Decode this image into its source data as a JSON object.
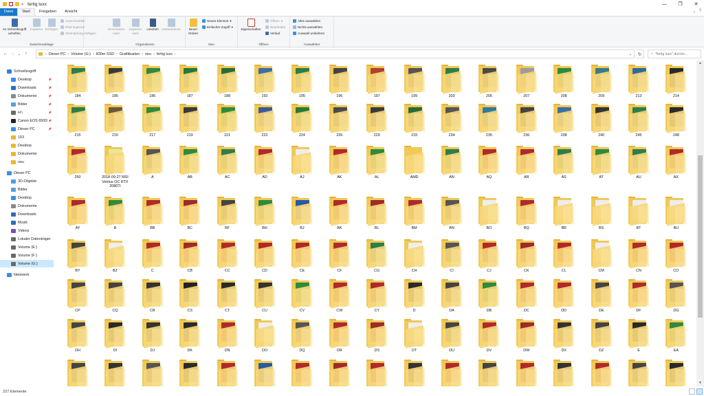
{
  "window": {
    "title": "fertig luxx",
    "minimize": "—",
    "maximize": "❐",
    "close": "✕"
  },
  "quick_access_toolbar": {
    "dropdown": "▾"
  },
  "ribbon_tabs": [
    {
      "label": "Datei",
      "kind": "file"
    },
    {
      "label": "Start",
      "kind": "active"
    },
    {
      "label": "Freigeben",
      "kind": ""
    },
    {
      "label": "Ansicht",
      "kind": ""
    }
  ],
  "ribbon_right": {
    "expand": "⌄",
    "help": "?"
  },
  "ribbon": {
    "clipboard": {
      "group": "Zwischenablage",
      "pin": "An Schnellzugriff anheften",
      "copy": "Kopieren",
      "paste": "Einfügen",
      "cut": "Ausschneiden",
      "copy_path": "Pfad kopieren",
      "paste_shortcut": "Verknüpfung einfügen"
    },
    "organize": {
      "group": "Organisieren",
      "move_to": "Verschieben nach",
      "copy_to": "Kopieren nach",
      "delete": "Löschen",
      "rename": "Umbenennen"
    },
    "new": {
      "group": "Neu",
      "new_folder": "Neuer Ordner",
      "new_item": "Neues Element",
      "easy_access": "Einfacher Zugriff"
    },
    "open": {
      "group": "Öffnen",
      "properties": "Eigenschaften",
      "open": "Öffnen",
      "edit": "Bearbeiten",
      "history": "Verlauf"
    },
    "select": {
      "group": "Auswählen",
      "select_all": "Alles auswählen",
      "select_none": "Nichts auswählen",
      "invert": "Auswahl umkehren"
    }
  },
  "address_bar": {
    "path": [
      "Dieser PC",
      "Volume (G:)",
      "830er SSD",
      "Grafikkarten",
      "neu",
      "fertig luxx"
    ],
    "search_placeholder": "\"fertig luxx\" durchs..."
  },
  "sidebar": [
    {
      "label": "Schnellzugriff",
      "icon": "star-icon",
      "color": "#2f7fd8",
      "indent": 0,
      "pin": false
    },
    {
      "label": "Desktop",
      "icon": "desktop-icon",
      "color": "#3a8fe0",
      "indent": 1,
      "pin": true
    },
    {
      "label": "Downloads",
      "icon": "download-icon",
      "color": "#2a6fc0",
      "indent": 1,
      "pin": true
    },
    {
      "label": "Dokumente",
      "icon": "documents-icon",
      "color": "#8a8a8a",
      "indent": 1,
      "pin": true
    },
    {
      "label": "Bilder",
      "icon": "pictures-icon",
      "color": "#5aa0d8",
      "indent": 1,
      "pin": true
    },
    {
      "label": "H:\\",
      "icon": "drive-icon",
      "color": "#6a6a6a",
      "indent": 1,
      "pin": true
    },
    {
      "label": "Canon EOS 650D",
      "icon": "camera-icon",
      "color": "#222222",
      "indent": 1,
      "pin": true
    },
    {
      "label": "Dieser PC",
      "icon": "computer-icon",
      "color": "#3a8fe0",
      "indent": 1,
      "pin": true
    },
    {
      "label": "153",
      "icon": "folder-icon",
      "color": "#e8b830",
      "indent": 1,
      "pin": false
    },
    {
      "label": "Desktop",
      "icon": "folder-icon",
      "color": "#e8b830",
      "indent": 1,
      "pin": false
    },
    {
      "label": "Dokumente",
      "icon": "folder-icon",
      "color": "#e8b830",
      "indent": 1,
      "pin": false
    },
    {
      "label": "neu",
      "icon": "folder-icon",
      "color": "#e8b830",
      "indent": 1,
      "pin": false
    },
    {
      "label": "Dieser PC",
      "icon": "computer-icon",
      "color": "#3a8fe0",
      "indent": 0,
      "pin": false
    },
    {
      "label": "3D-Objekte",
      "icon": "3d-objects-icon",
      "color": "#4aa0e8",
      "indent": 1,
      "pin": false
    },
    {
      "label": "Bilder",
      "icon": "pictures-icon",
      "color": "#5aa0d8",
      "indent": 1,
      "pin": false
    },
    {
      "label": "Desktop",
      "icon": "desktop-icon",
      "color": "#3a8fe0",
      "indent": 1,
      "pin": false
    },
    {
      "label": "Dokumente",
      "icon": "documents-icon",
      "color": "#8a8a8a",
      "indent": 1,
      "pin": false
    },
    {
      "label": "Downloads",
      "icon": "download-icon",
      "color": "#2a6fc0",
      "indent": 1,
      "pin": false
    },
    {
      "label": "Musik",
      "icon": "music-icon",
      "color": "#2a6fc0",
      "indent": 1,
      "pin": false
    },
    {
      "label": "Videos",
      "icon": "videos-icon",
      "color": "#7a4ac0",
      "indent": 1,
      "pin": false
    },
    {
      "label": "Lokaler Datenträger",
      "icon": "drive-icon",
      "color": "#6a6a6a",
      "indent": 1,
      "pin": false
    },
    {
      "label": "Volume (E:)",
      "icon": "drive-icon",
      "color": "#6a6a6a",
      "indent": 1,
      "pin": false
    },
    {
      "label": "Volume (F:)",
      "icon": "drive-icon",
      "color": "#6a6a6a",
      "indent": 1,
      "pin": false
    },
    {
      "label": "Volume (G:)",
      "icon": "drive-icon",
      "color": "#6a6a6a",
      "indent": 1,
      "pin": false,
      "selected": true
    },
    {
      "label": "Netzwerk",
      "icon": "network-icon",
      "color": "#3a8fe0",
      "indent": 0,
      "pin": false
    }
  ],
  "folders": [
    {
      "name": "184",
      "thumb": "#2e7d4a"
    },
    {
      "name": "185",
      "thumb": "#3a3a3a"
    },
    {
      "name": "186",
      "thumb": "#2f8a3c"
    },
    {
      "name": "187",
      "thumb": "#247a3a"
    },
    {
      "name": "188",
      "thumb": "#2a6b3a"
    },
    {
      "name": "192",
      "thumb": "#3c6ea8"
    },
    {
      "name": "195",
      "thumb": "#2d7d45"
    },
    {
      "name": "196",
      "thumb": "#444444"
    },
    {
      "name": "197",
      "thumb": "#b0412e"
    },
    {
      "name": "199",
      "thumb": "#555555"
    },
    {
      "name": "203",
      "thumb": "#2e7d4a"
    },
    {
      "name": "206",
      "thumb": "#4a4a4a"
    },
    {
      "name": "207",
      "thumb": "#9c9c9c"
    },
    {
      "name": "208",
      "thumb": "#2f8a3c"
    },
    {
      "name": "209",
      "thumb": "#3a7a8a"
    },
    {
      "name": "213",
      "thumb": "#2f6aa0"
    },
    {
      "name": "214",
      "thumb": "#2a2a2a"
    },
    {
      "name": "215",
      "thumb": "#2e7d4a"
    },
    {
      "name": "216",
      "thumb": "#6a5a3a"
    },
    {
      "name": "217",
      "thumb": "#2f8a3c"
    },
    {
      "name": "219",
      "thumb": "#3a3a3a"
    },
    {
      "name": "221",
      "thumb": "#2f8a3c"
    },
    {
      "name": "222",
      "thumb": "#3a5a9a"
    },
    {
      "name": "224",
      "thumb": "#2a7a3a"
    },
    {
      "name": "226",
      "thumb": "#4a4a4a"
    },
    {
      "name": "229",
      "thumb": "#3a3a3a"
    },
    {
      "name": "233",
      "thumb": "#2a6a3a"
    },
    {
      "name": "234",
      "thumb": "#555555"
    },
    {
      "name": "235",
      "thumb": "#2f7aa0"
    },
    {
      "name": "236",
      "thumb": "#444444"
    },
    {
      "name": "238",
      "thumb": "#3a6ea8"
    },
    {
      "name": "240",
      "thumb": "#333333"
    },
    {
      "name": "245",
      "thumb": "#2e7d4a"
    },
    {
      "name": "248",
      "thumb": "#2a2a2a"
    },
    {
      "name": "250",
      "thumb": "#b02a2a"
    },
    {
      "name": "2018-09-27 MSI Ventus OC RTX 2080Ti",
      "thumb": "#3a3a3a",
      "open": true
    },
    {
      "name": "A",
      "thumb": "#555555"
    },
    {
      "name": "AB",
      "thumb": "#2f8a3c"
    },
    {
      "name": "AC",
      "thumb": "#2e7d4a"
    },
    {
      "name": "AD",
      "thumb": "#b02a2a"
    },
    {
      "name": "AJ",
      "thumb": "#eeeeee"
    },
    {
      "name": "AK",
      "thumb": "#b02a2a"
    },
    {
      "name": "AL",
      "thumb": "#2f8a3c"
    },
    {
      "name": "AMD",
      "thumb": "#f0c956"
    },
    {
      "name": "AN",
      "thumb": "#2e7d4a"
    },
    {
      "name": "AQ",
      "thumb": "#b02a2a"
    },
    {
      "name": "AR",
      "thumb": "#b02a2a"
    },
    {
      "name": "AS",
      "thumb": "#2e7d4a"
    },
    {
      "name": "AT",
      "thumb": "#2f8a3c"
    },
    {
      "name": "AU",
      "thumb": "#2e7d4a"
    },
    {
      "name": "AX",
      "thumb": "#b02a2a"
    },
    {
      "name": "AY",
      "thumb": "#b02a2a"
    },
    {
      "name": "B",
      "thumb": "#2f8a3c"
    },
    {
      "name": "BB",
      "thumb": "#b02a2a"
    },
    {
      "name": "BC",
      "thumb": "#a02a2a"
    },
    {
      "name": "BF",
      "thumb": "#444444"
    },
    {
      "name": "BH",
      "thumb": "#2f8a3c"
    },
    {
      "name": "BJ",
      "thumb": "#2a5aa0"
    },
    {
      "name": "BK",
      "thumb": "#b02a2a"
    },
    {
      "name": "BL",
      "thumb": "#a02a2a"
    },
    {
      "name": "BM",
      "thumb": "#b02a2a"
    },
    {
      "name": "BN",
      "thumb": "#555555"
    },
    {
      "name": "BO",
      "thumb": "#eeeeee"
    },
    {
      "name": "BQ",
      "thumb": "#b02a2a"
    },
    {
      "name": "BR",
      "thumb": "#eeeeee"
    },
    {
      "name": "BS",
      "thumb": "#eeeeee"
    },
    {
      "name": "BT",
      "thumb": "#eeeeee"
    },
    {
      "name": "BU",
      "thumb": "#eeeeee"
    },
    {
      "name": "BY",
      "thumb": "#444444"
    },
    {
      "name": "BZ",
      "thumb": "#eeeeee"
    },
    {
      "name": "C",
      "thumb": "#b02a2a"
    },
    {
      "name": "CB",
      "thumb": "#a02a2a"
    },
    {
      "name": "CC",
      "thumb": "#b02a2a"
    },
    {
      "name": "CD",
      "thumb": "#b02a2a"
    },
    {
      "name": "CE",
      "thumb": "#b02a2a"
    },
    {
      "name": "CF",
      "thumb": "#b02a2a"
    },
    {
      "name": "CG",
      "thumb": "#2e7d4a"
    },
    {
      "name": "CH",
      "thumb": "#eeeeee"
    },
    {
      "name": "CI",
      "thumb": "#555555"
    },
    {
      "name": "CJ",
      "thumb": "#b02a2a"
    },
    {
      "name": "CK",
      "thumb": "#a02a2a"
    },
    {
      "name": "CL",
      "thumb": "#b02a2a"
    },
    {
      "name": "CM",
      "thumb": "#eeeeee"
    },
    {
      "name": "CN",
      "thumb": "#b02a2a"
    },
    {
      "name": "CO",
      "thumb": "#b02a2a"
    },
    {
      "name": "CP",
      "thumb": "#444444"
    },
    {
      "name": "CQ",
      "thumb": "#444444"
    },
    {
      "name": "CR",
      "thumb": "#333333"
    },
    {
      "name": "CS",
      "thumb": "#222222"
    },
    {
      "name": "CT",
      "thumb": "#2a2a2a"
    },
    {
      "name": "CU",
      "thumb": "#333333"
    },
    {
      "name": "CV",
      "thumb": "#2f8a3c"
    },
    {
      "name": "CW",
      "thumb": "#b02a2a"
    },
    {
      "name": "CY",
      "thumb": "#b02a2a"
    },
    {
      "name": "D",
      "thumb": "#2a2a2a"
    },
    {
      "name": "DA",
      "thumb": "#444444"
    },
    {
      "name": "DB",
      "thumb": "#2f8a3c"
    },
    {
      "name": "DC",
      "thumb": "#b02a2a"
    },
    {
      "name": "DD",
      "thumb": "#b02a2a"
    },
    {
      "name": "DE",
      "thumb": "#444444"
    },
    {
      "name": "DF",
      "thumb": "#b02a2a"
    },
    {
      "name": "DG",
      "thumb": "#555555"
    },
    {
      "name": "DH",
      "thumb": "#444444"
    },
    {
      "name": "DI",
      "thumb": "#2a2a2a"
    },
    {
      "name": "DJ",
      "thumb": "#333333"
    },
    {
      "name": "DK",
      "thumb": "#2a2a2a"
    },
    {
      "name": "DN",
      "thumb": "#b02a2a"
    },
    {
      "name": "DO",
      "thumb": "#eeeeee"
    },
    {
      "name": "DQ",
      "thumb": "#555555"
    },
    {
      "name": "DR",
      "thumb": "#b02a2a"
    },
    {
      "name": "DS",
      "thumb": "#a02a2a"
    },
    {
      "name": "DT",
      "thumb": "#eeeeee"
    },
    {
      "name": "DU",
      "thumb": "#444444"
    },
    {
      "name": "DV",
      "thumb": "#b02a2a"
    },
    {
      "name": "DW",
      "thumb": "#a02a2a"
    },
    {
      "name": "DX",
      "thumb": "#333333"
    },
    {
      "name": "DZ",
      "thumb": "#444444"
    },
    {
      "name": "E",
      "thumb": "#2a2a2a"
    },
    {
      "name": "EA",
      "thumb": "#2f8a3c"
    },
    {
      "name": "",
      "thumb": "#444444"
    },
    {
      "name": "",
      "thumb": "#333333"
    },
    {
      "name": "",
      "thumb": "#555555"
    },
    {
      "name": "",
      "thumb": "#2a2a2a"
    },
    {
      "name": "",
      "thumb": "#b02a2a"
    },
    {
      "name": "",
      "thumb": "#2a5aa0"
    },
    {
      "name": "",
      "thumb": "#b02a2a"
    },
    {
      "name": "",
      "thumb": "#a02a2a"
    },
    {
      "name": "",
      "thumb": "#b02a2a"
    },
    {
      "name": "",
      "thumb": "#333333"
    },
    {
      "name": "",
      "thumb": "#b02a2a"
    },
    {
      "name": "",
      "thumb": "#444444"
    },
    {
      "name": "",
      "thumb": "#b02a2a"
    },
    {
      "name": "",
      "thumb": "#333333"
    },
    {
      "name": "",
      "thumb": "#b02a2a"
    },
    {
      "name": "",
      "thumb": "#444444"
    },
    {
      "name": "",
      "thumb": "#2a2a2a"
    }
  ],
  "status_bar": {
    "count": "227 Elemente"
  },
  "colors": {
    "accent": "#1979ca",
    "selection": "#cce8ff",
    "folder": "#f0c956"
  }
}
